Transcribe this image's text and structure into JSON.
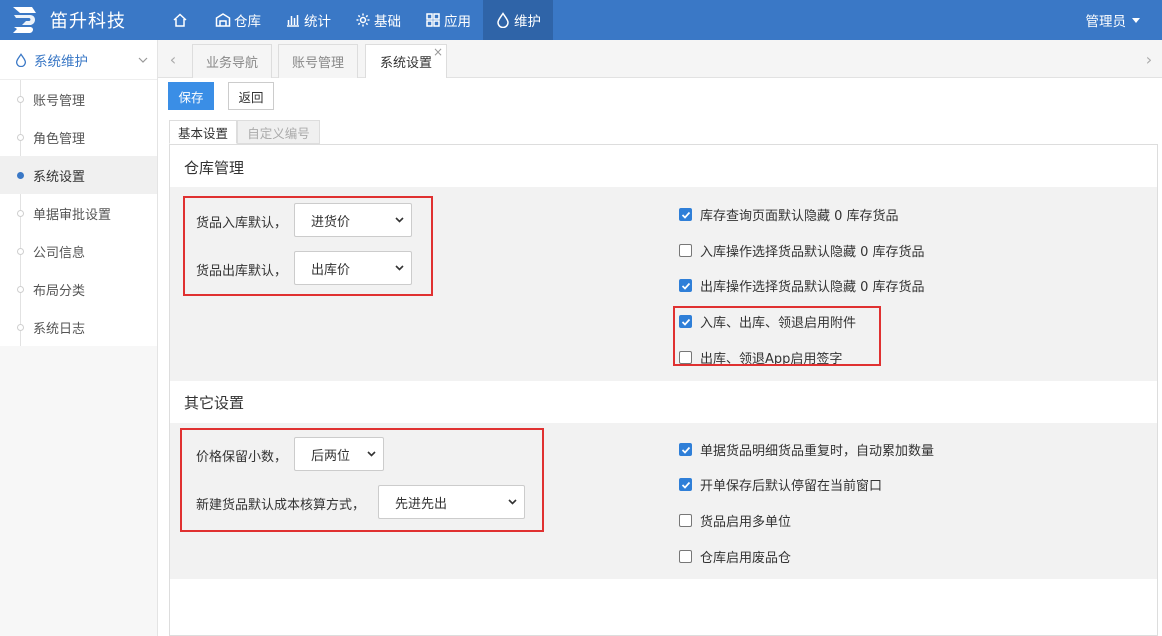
{
  "app": {
    "title": "笛升科技",
    "user": "管理员"
  },
  "nav": [
    {
      "label": "",
      "icon": "home-icon"
    },
    {
      "label": "仓库",
      "icon": "warehouse-icon"
    },
    {
      "label": "统计",
      "icon": "chart-icon"
    },
    {
      "label": "基础",
      "icon": "gear-icon"
    },
    {
      "label": "应用",
      "icon": "grid-icon"
    },
    {
      "label": "维护",
      "icon": "drop-icon",
      "active": true
    }
  ],
  "sidebar": {
    "header": "系统维护",
    "items": [
      "账号管理",
      "角色管理",
      "系统设置",
      "单据审批设置",
      "公司信息",
      "布局分类",
      "系统日志"
    ],
    "active": "系统设置"
  },
  "tabs": [
    {
      "label": "业务导航"
    },
    {
      "label": "账号管理"
    },
    {
      "label": "系统设置",
      "active": true,
      "close": "×"
    }
  ],
  "toolbar": {
    "save": "保存",
    "back": "返回"
  },
  "settings_tabs": [
    {
      "label": "基本设置",
      "active": true
    },
    {
      "label": "自定义编号"
    }
  ],
  "warehouse": {
    "title": "仓库管理",
    "fields": [
      {
        "label": "货品入库默认，",
        "value": "进货价"
      },
      {
        "label": "货品出库默认，",
        "value": "出库价"
      }
    ],
    "checks": [
      {
        "label": "库存查询页面默认隐藏 0 库存货品",
        "checked": true
      },
      {
        "label": "入库操作选择货品默认隐藏 0 库存货品",
        "checked": false
      },
      {
        "label": "出库操作选择货品默认隐藏 0 库存货品",
        "checked": true
      },
      {
        "label": "入库、出库、领退启用附件",
        "checked": true
      },
      {
        "label": "出库、领退App启用签字",
        "checked": false
      }
    ]
  },
  "other": {
    "title": "其它设置",
    "fields": [
      {
        "label": "价格保留小数，",
        "value": "后两位"
      },
      {
        "label": "新建货品默认成本核算方式，",
        "value": "先进先出"
      }
    ],
    "checks": [
      {
        "label": "单据货品明细货品重复时，自动累加数量",
        "checked": true
      },
      {
        "label": "开单保存后默认停留在当前窗口",
        "checked": true
      },
      {
        "label": "货品启用多单位",
        "checked": false
      },
      {
        "label": "仓库启用废品仓",
        "checked": false
      }
    ]
  }
}
